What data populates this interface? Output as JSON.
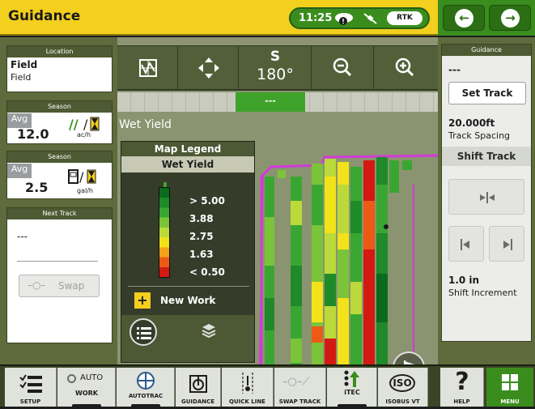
{
  "header": {
    "title": "Guidance",
    "time": "11:25",
    "rtk_label": "RTK"
  },
  "location": {
    "title": "Location",
    "line1": "Field",
    "line2": "Field"
  },
  "season1": {
    "title": "Season",
    "avg_label": "Avg",
    "value": "12.0",
    "unit": "ac/h"
  },
  "season2": {
    "title": "Season",
    "avg_label": "Avg",
    "value": "2.5",
    "unit": "gal/h"
  },
  "next_track": {
    "title": "Next Track",
    "value": "---",
    "swap_label": "Swap"
  },
  "toolbar": {
    "heading_letter": "S",
    "heading_deg": "180°",
    "track_indicator": "---"
  },
  "map": {
    "layer_label": "Wet Yield",
    "legend_title": "Map Legend",
    "legend_subtitle": "Wet Yield",
    "legend_levels": [
      "> 5.00",
      "3.88",
      "2.75",
      "1.63",
      "< 0.50"
    ],
    "legend_colors": [
      "#0a6a1d",
      "#1e8a2a",
      "#3aa632",
      "#7bc43a",
      "#bcd93a",
      "#f2e21a",
      "#f4a21a",
      "#ec5a16",
      "#d21a12"
    ],
    "new_work_label": "New Work"
  },
  "guidance_panel": {
    "title": "Guidance",
    "value": "---",
    "set_track_label": "Set Track",
    "spacing_value": "20.000ft",
    "spacing_label": "Track Spacing",
    "shift_title": "Shift Track",
    "increment_value": "1.0 in",
    "increment_label": "Shift Increment"
  },
  "bottom_bar": {
    "setup": "SETUP",
    "work_auto": "AUTO",
    "work": "WORK",
    "autotrac": "AUTOTRAC",
    "guidance": "GUIDANCE",
    "quick_line": "QUICK LINE",
    "swap_track": "SWAP TRACK",
    "itec": "iTEC",
    "isobus": "ISOBUS VT",
    "iso_text": "ISO",
    "help": "HELP",
    "menu": "MENU"
  }
}
